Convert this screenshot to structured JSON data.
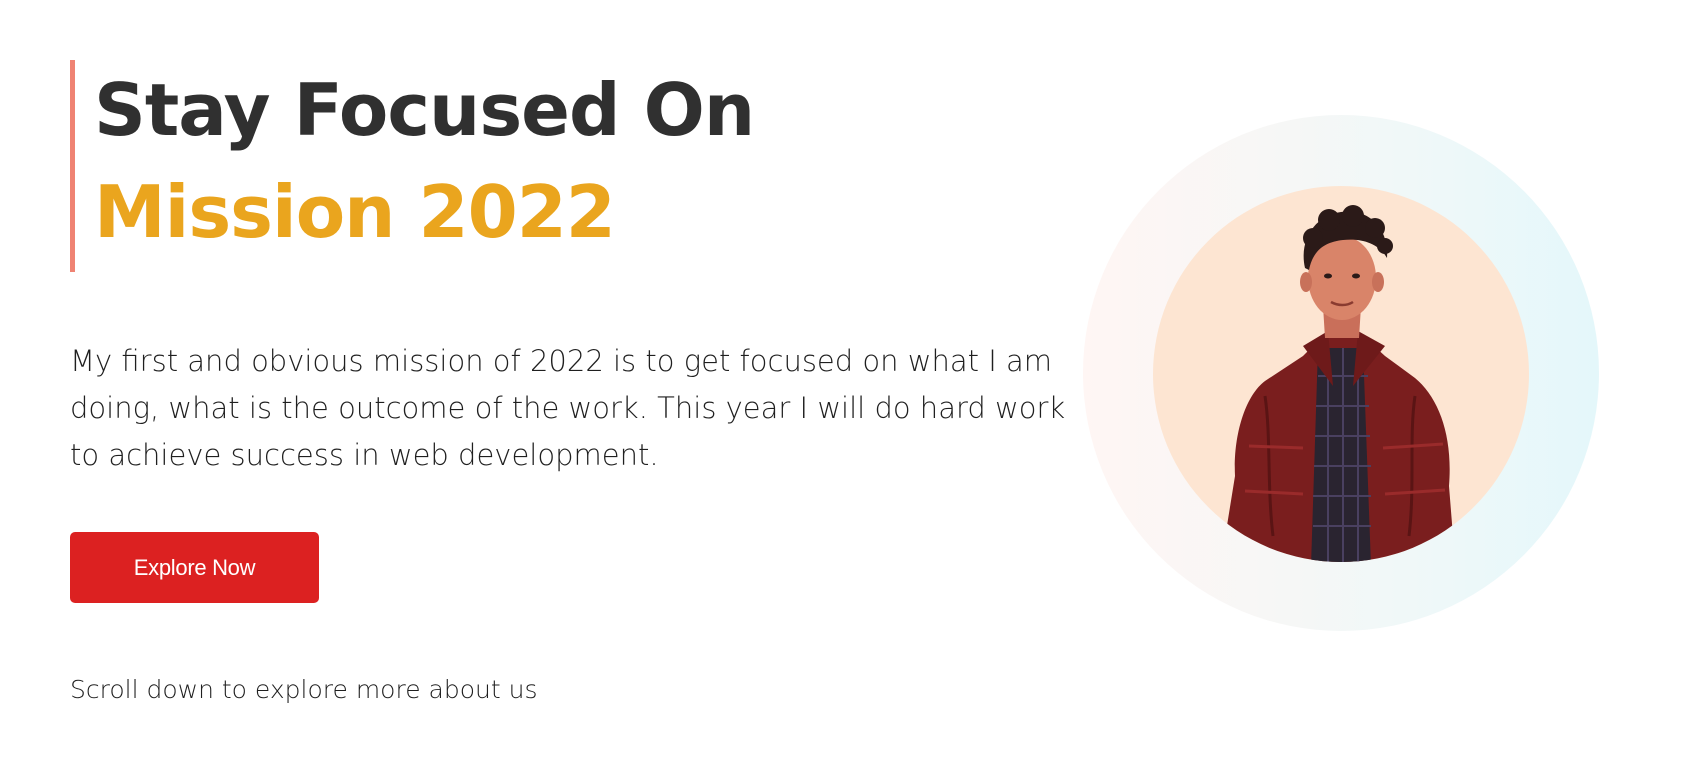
{
  "hero": {
    "title_line_1": "Stay Focused On",
    "title_line_2": "Mission 2022",
    "description": "My first and obvious mission of 2022 is to get focused on what I am doing, what is the outcome of the work. This year I will do hard work to achieve success in web development.",
    "cta_label": "Explore Now",
    "scroll_hint": "Scroll down to explore more about us"
  },
  "profile": {
    "image_icon": "portrait-photo"
  },
  "colors": {
    "accent_bar": "#ef8373",
    "title_dark": "#303030",
    "title_highlight": "#eaa51e",
    "button_bg": "#dc2121",
    "avatar_bg": "#fde5d2"
  }
}
